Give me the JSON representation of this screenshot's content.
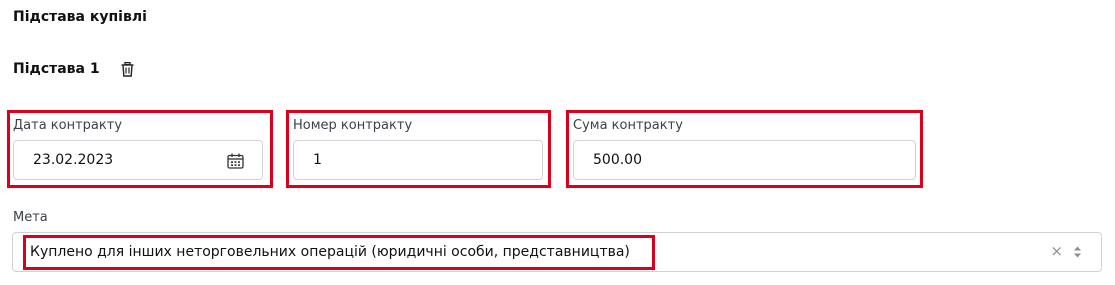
{
  "section": {
    "title": "Підстава купівлі"
  },
  "basis": {
    "title": "Підстава 1",
    "delete_icon": "trash-icon"
  },
  "fields": {
    "contract_date": {
      "label": "Дата контракту",
      "value": "23.02.2023",
      "icon": "calendar-icon"
    },
    "contract_number": {
      "label": "Номер контракту",
      "value": "1"
    },
    "contract_sum": {
      "label": "Сума контракту",
      "value": "500.00"
    }
  },
  "purpose": {
    "label": "Мета",
    "value": "Куплено для інших неторговельних операцій (юридичні особи, представництва)",
    "clear_icon": "clear-icon",
    "toggle_icon": "chevron-up-down-icon"
  },
  "colors": {
    "highlight": "#d9001b",
    "border": "#cfd3d8",
    "text": "#111111"
  }
}
